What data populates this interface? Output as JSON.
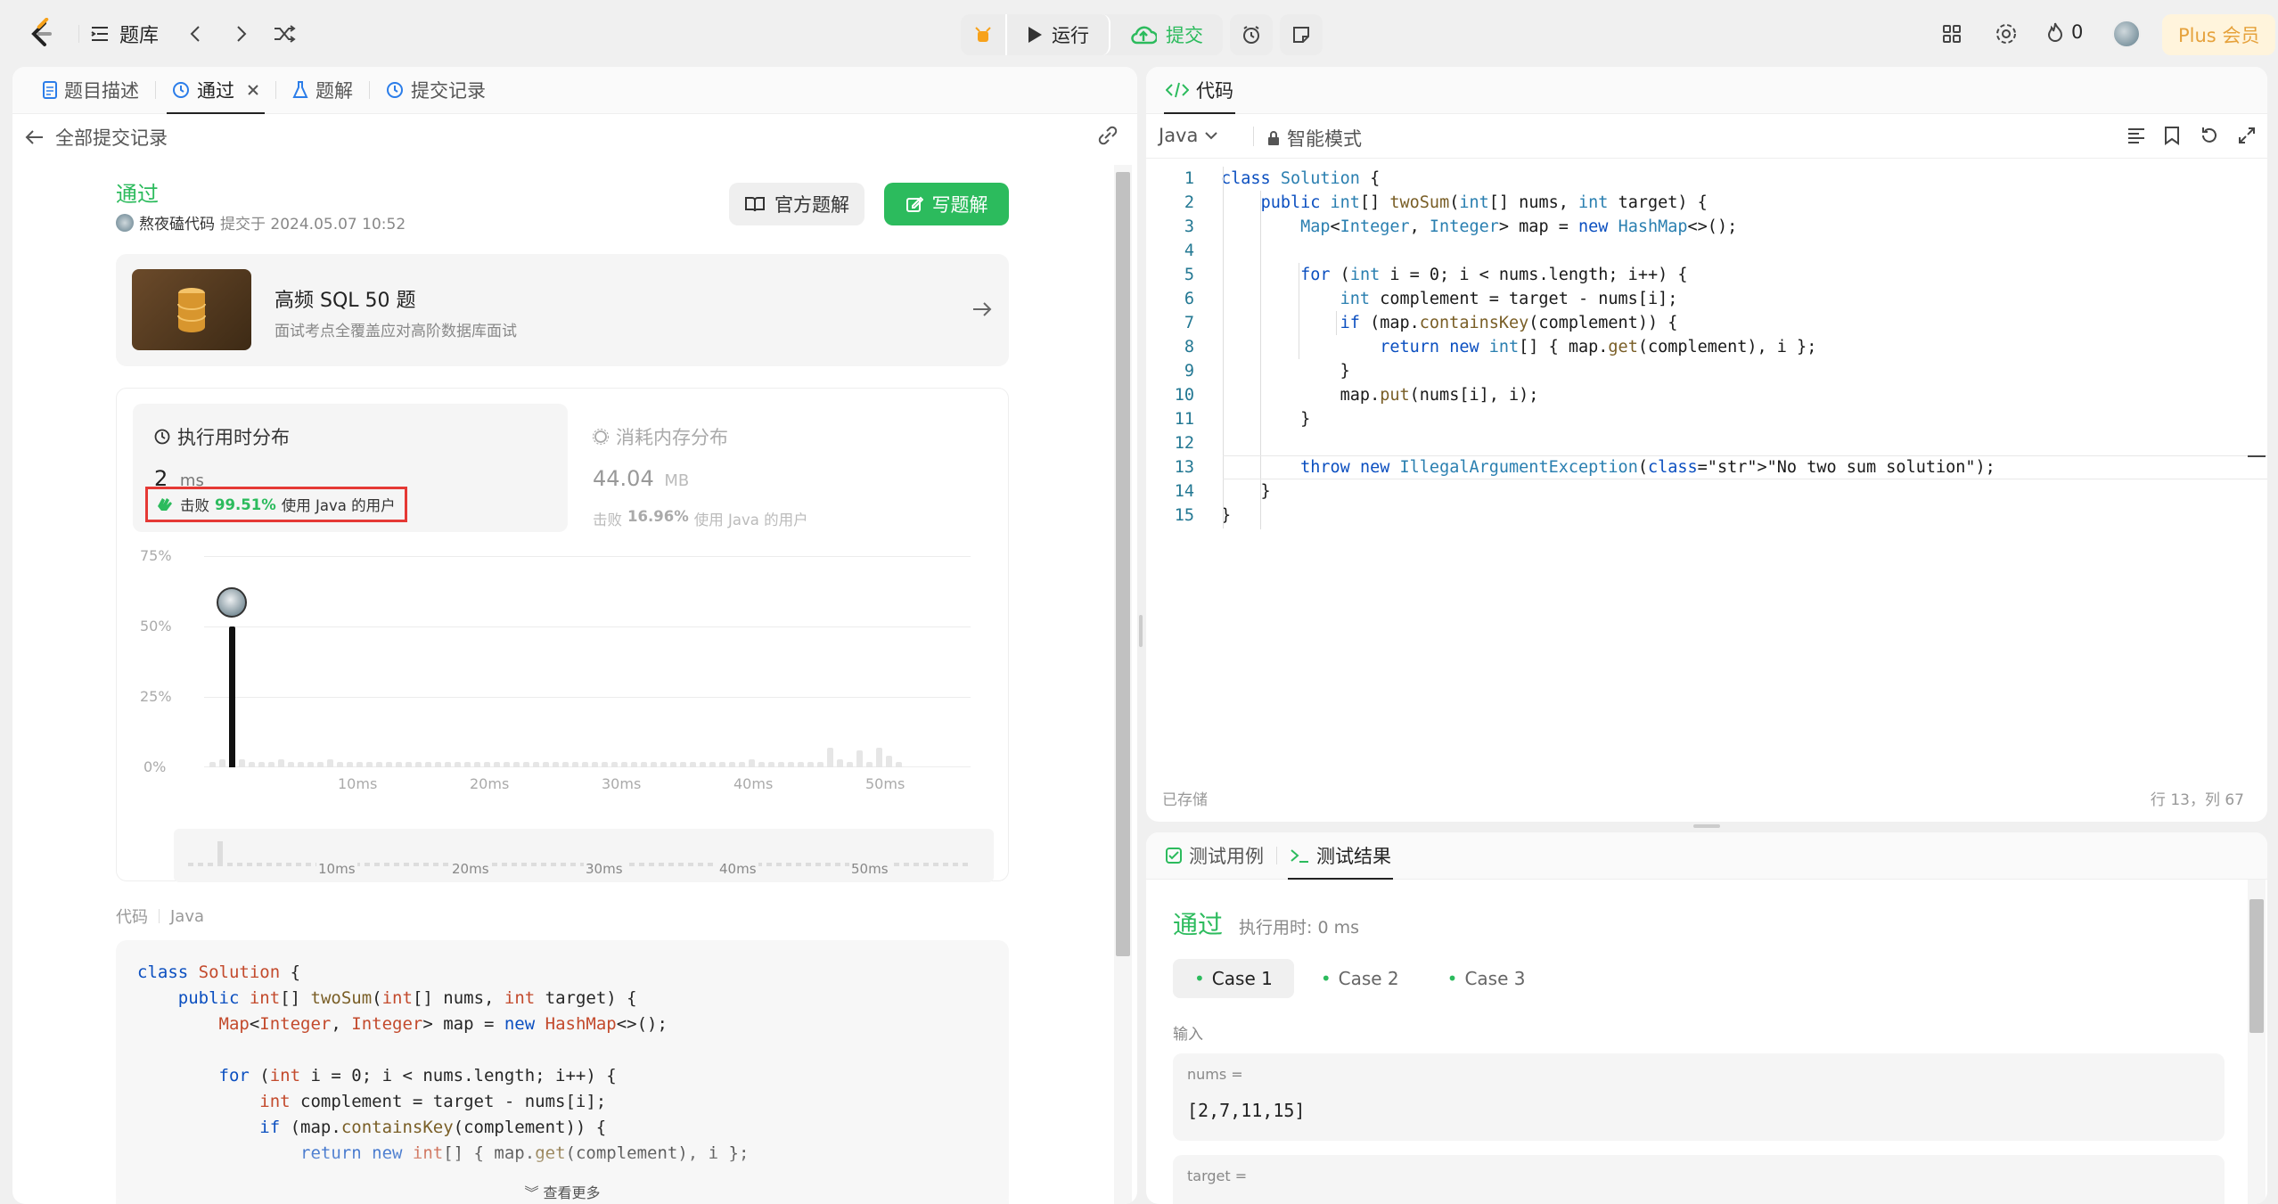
{
  "topbar": {
    "problems_label": "题库",
    "run_label": "运行",
    "submit_label": "提交",
    "fire_count": "0",
    "plus_label": "Plus 会员"
  },
  "left_tabs": [
    {
      "label": "题目描述"
    },
    {
      "label": "通过"
    },
    {
      "label": "题解"
    },
    {
      "label": "提交记录"
    }
  ],
  "back_link": "全部提交记录",
  "submission": {
    "status": "通过",
    "user": "熬夜磕代码",
    "submitted_at": "提交于 2024.05.07 10:52",
    "official_solution_label": "官方题解",
    "write_solution_label": "写题解"
  },
  "banner": {
    "title": "高频 SQL 50 题",
    "subtitle": "面试考点全覆盖应对高阶数据库面试"
  },
  "runtime": {
    "title": "执行用时分布",
    "value": "2",
    "unit": "ms",
    "beats_prefix": "击败",
    "beats_pct": "99.51%",
    "beats_suffix": "使用 Java 的用户"
  },
  "memory": {
    "title": "消耗内存分布",
    "value": "44.04",
    "unit": "MB",
    "beats_prefix": "击败",
    "beats_pct": "16.96%",
    "beats_suffix": "使用 Java 的用户"
  },
  "chart_data": {
    "type": "bar",
    "y_ticks": [
      "75%",
      "50%",
      "25%",
      "0%"
    ],
    "x_ticks": [
      "10ms",
      "20ms",
      "30ms",
      "40ms",
      "50ms"
    ],
    "ylim": [
      0,
      75
    ],
    "highlight": {
      "x": "2ms",
      "value": 50
    }
  },
  "code_section": {
    "label": "代码",
    "language": "Java",
    "more_label": "查看更多",
    "lines": [
      "class Solution {",
      "    public int[] twoSum(int[] nums, int target) {",
      "        Map<Integer, Integer> map = new HashMap<>();",
      "",
      "        for (int i = 0; i < nums.length; i++) {",
      "            int complement = target - nums[i];",
      "            if (map.containsKey(complement)) {",
      "                return new int[] { map.get(complement), i };"
    ]
  },
  "editor": {
    "tab_label": "代码",
    "language": "Java",
    "mode_label": "智能模式",
    "saved_label": "已存储",
    "cursor_pos": "行 13，列 67",
    "lines": [
      "class Solution {",
      "    public int[] twoSum(int[] nums, int target) {",
      "        Map<Integer, Integer> map = new HashMap<>();",
      "",
      "        for (int i = 0; i < nums.length; i++) {",
      "            int complement = target - nums[i];",
      "            if (map.containsKey(complement)) {",
      "                return new int[] { map.get(complement), i };",
      "            }",
      "            map.put(nums[i], i);",
      "        }",
      "",
      "        throw new IllegalArgumentException(\"No two sum solution\");",
      "    }",
      "}"
    ]
  },
  "testpanel": {
    "tab_cases": "测试用例",
    "tab_results": "测试结果",
    "status": "通过",
    "runtime": "执行用时: 0 ms",
    "cases": [
      "Case 1",
      "Case 2",
      "Case 3"
    ],
    "input_label": "输入",
    "nums_label": "nums =",
    "nums_value": "[2,7,11,15]",
    "target_label": "target ="
  },
  "colors": {
    "accent_green": "#2cbb5d",
    "run_bg": "#ececec",
    "highlight_red": "#e53935",
    "plus_bg": "#fff4dc",
    "plus_text": "#e6a23c"
  }
}
